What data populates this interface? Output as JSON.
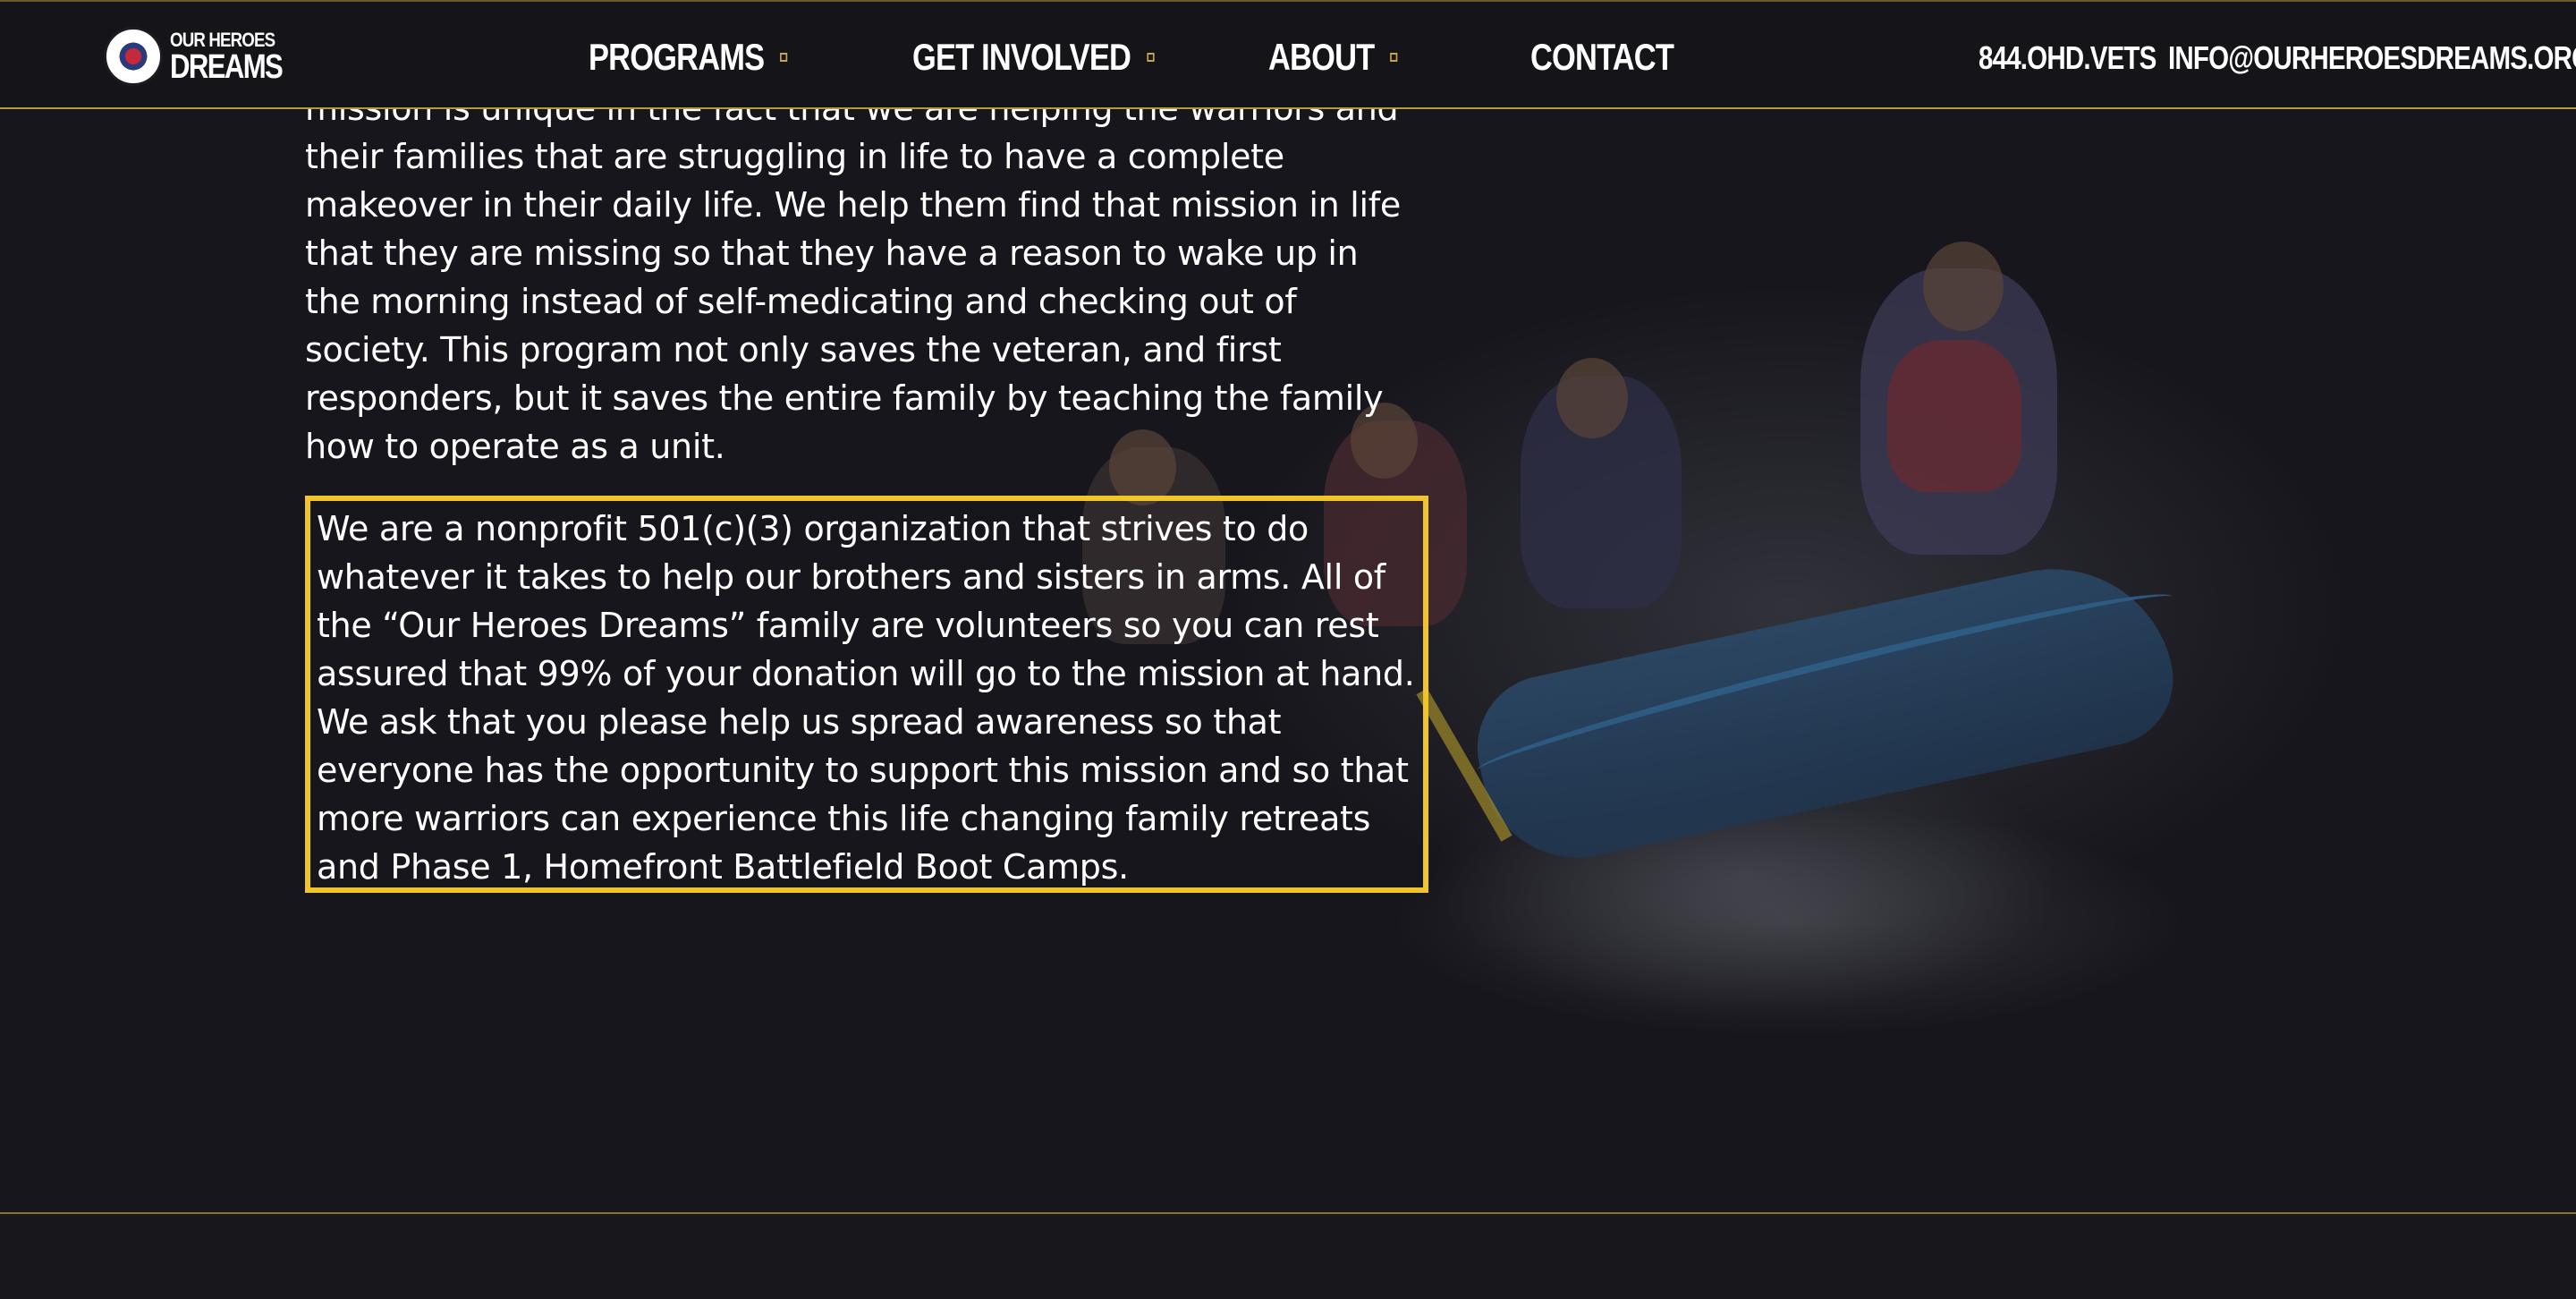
{
  "brand": {
    "logo_top": "OUR HEROES",
    "logo_main": "DREAMS",
    "accent_color": "#f0c52b"
  },
  "nav": {
    "items": [
      {
        "label": "PROGRAMS",
        "has_dropdown": true
      },
      {
        "label": "GET INVOLVED",
        "has_dropdown": true
      },
      {
        "label": "ABOUT",
        "has_dropdown": true
      },
      {
        "label": "CONTACT",
        "has_dropdown": false
      }
    ],
    "phone": "844.OHD.VETS",
    "email": "INFO@OURHEROESDREAMS.ORG"
  },
  "content": {
    "paragraph1": "mission is unique in the fact that we are helping the warriors and their families that are struggling in life to have a complete makeover in their daily life. We help them find that mission in life that they are missing so that they have a reason to wake up in the morning instead of self-medicating and checking out of society. This program not only saves the veteran, and first responders, but it saves the entire family by teaching the family how to operate as a unit.",
    "paragraph2": "We are a nonprofit 501(c)(3) organization that strives to do whatever it takes to help our brothers and sisters in arms. All of the “Our Heroes Dreams” family are volunteers so you can rest assured that 99% of your donation will go to the mission at hand. We ask that you please help us spread awareness so that everyone has the opportunity to support this mission and so that more warriors can experience this life changing family retreats and Phase 1, Homefront Battlefield Boot Camps."
  }
}
